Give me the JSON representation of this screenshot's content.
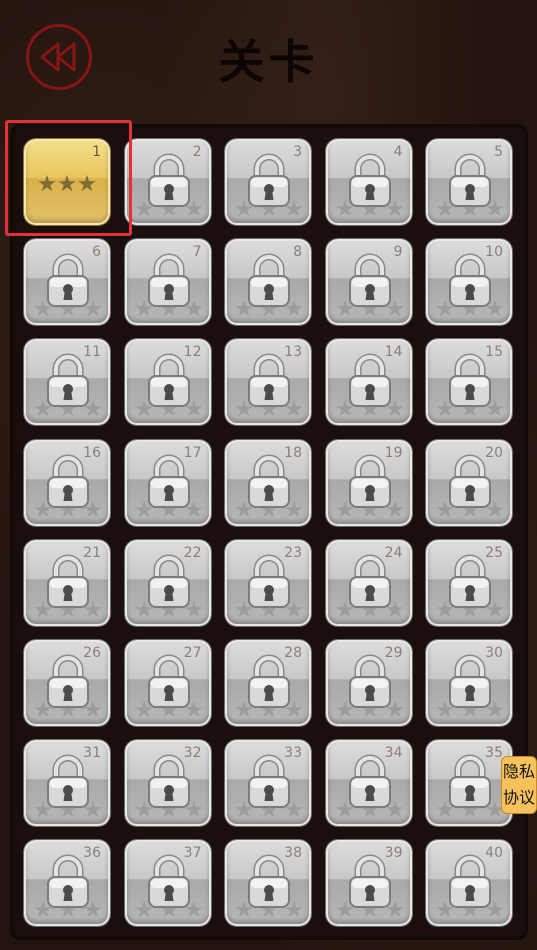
{
  "header": {
    "title": "关卡",
    "back_icon": "rewind-icon",
    "back_color": "#8a1515"
  },
  "levels": [
    {
      "number": "1",
      "locked": false,
      "stars": 3
    },
    {
      "number": "2",
      "locked": true
    },
    {
      "number": "3",
      "locked": true
    },
    {
      "number": "4",
      "locked": true
    },
    {
      "number": "5",
      "locked": true
    },
    {
      "number": "6",
      "locked": true
    },
    {
      "number": "7",
      "locked": true
    },
    {
      "number": "8",
      "locked": true
    },
    {
      "number": "9",
      "locked": true
    },
    {
      "number": "10",
      "locked": true
    },
    {
      "number": "11",
      "locked": true
    },
    {
      "number": "12",
      "locked": true
    },
    {
      "number": "13",
      "locked": true
    },
    {
      "number": "14",
      "locked": true
    },
    {
      "number": "15",
      "locked": true
    },
    {
      "number": "16",
      "locked": true
    },
    {
      "number": "17",
      "locked": true
    },
    {
      "number": "18",
      "locked": true
    },
    {
      "number": "19",
      "locked": true
    },
    {
      "number": "20",
      "locked": true
    },
    {
      "number": "21",
      "locked": true
    },
    {
      "number": "22",
      "locked": true
    },
    {
      "number": "23",
      "locked": true
    },
    {
      "number": "24",
      "locked": true
    },
    {
      "number": "25",
      "locked": true
    },
    {
      "number": "26",
      "locked": true
    },
    {
      "number": "27",
      "locked": true
    },
    {
      "number": "28",
      "locked": true
    },
    {
      "number": "29",
      "locked": true
    },
    {
      "number": "30",
      "locked": true
    },
    {
      "number": "31",
      "locked": true
    },
    {
      "number": "32",
      "locked": true
    },
    {
      "number": "33",
      "locked": true
    },
    {
      "number": "34",
      "locked": true
    },
    {
      "number": "35",
      "locked": true
    },
    {
      "number": "36",
      "locked": true
    },
    {
      "number": "37",
      "locked": true
    },
    {
      "number": "38",
      "locked": true
    },
    {
      "number": "39",
      "locked": true
    },
    {
      "number": "40",
      "locked": true
    }
  ],
  "privacy": {
    "line1": "隐私",
    "line2": "协议",
    "color": "#f7c15b"
  },
  "selection_color": "#e1323a"
}
